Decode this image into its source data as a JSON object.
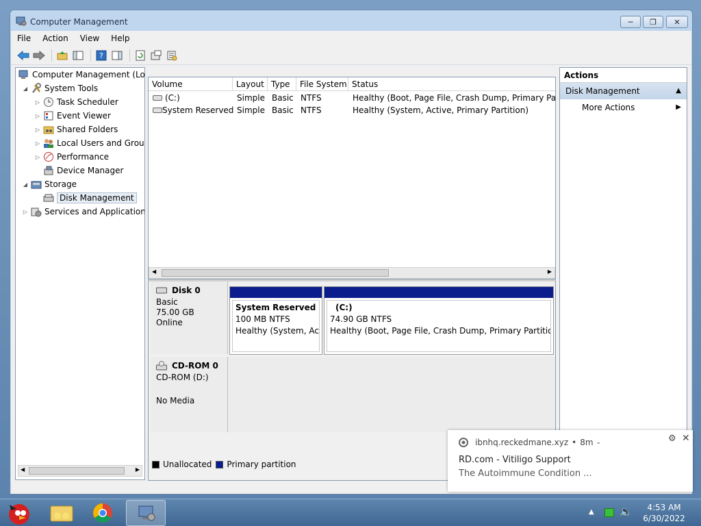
{
  "window": {
    "title": "Computer Management"
  },
  "menu": [
    "File",
    "Action",
    "View",
    "Help"
  ],
  "tree": {
    "root": "Computer Management (Local)",
    "system_tools": "System Tools",
    "task_scheduler": "Task Scheduler",
    "event_viewer": "Event Viewer",
    "shared_folders": "Shared Folders",
    "local_users": "Local Users and Groups",
    "performance": "Performance",
    "device_manager": "Device Manager",
    "storage": "Storage",
    "disk_management": "Disk Management",
    "services": "Services and Applications"
  },
  "volumes": {
    "headers": [
      "Volume",
      "Layout",
      "Type",
      "File System",
      "Status"
    ],
    "rows": [
      [
        "(C:)",
        "Simple",
        "Basic",
        "NTFS",
        "Healthy (Boot, Page File, Crash Dump, Primary Partition)"
      ],
      [
        "System Reserved",
        "Simple",
        "Basic",
        "NTFS",
        "Healthy (System, Active, Primary Partition)"
      ]
    ]
  },
  "disk0": {
    "name": "Disk 0",
    "type": "Basic",
    "size": "75.00 GB",
    "state": "Online",
    "partitions": [
      {
        "name": "System Reserved",
        "size": "100 MB NTFS",
        "status": "Healthy (System, Active, Primary Partition)"
      },
      {
        "name": "(C:)",
        "size": "74.90 GB NTFS",
        "status": "Healthy (Boot, Page File, Crash Dump, Primary Partition)"
      }
    ]
  },
  "cdrom0": {
    "name": "CD-ROM 0",
    "drive": "CD-ROM (D:)",
    "media": "No Media"
  },
  "legend": {
    "unallocated": "Unallocated",
    "primary": "Primary partition"
  },
  "actions": {
    "title": "Actions",
    "section": "Disk Management",
    "more": "More Actions"
  },
  "notification": {
    "source": "ibnhq.reckedmane.xyz",
    "age": "8m",
    "title": "RD.com - Vitiligo Support",
    "body": "The Autoimmune Condition ..."
  },
  "clock": {
    "time": "4:53 AM",
    "date": "6/30/2022"
  },
  "colors": {
    "primary_partition": "#0b1d8c",
    "unallocated": "#000000",
    "selection": "#c5d6ea"
  }
}
